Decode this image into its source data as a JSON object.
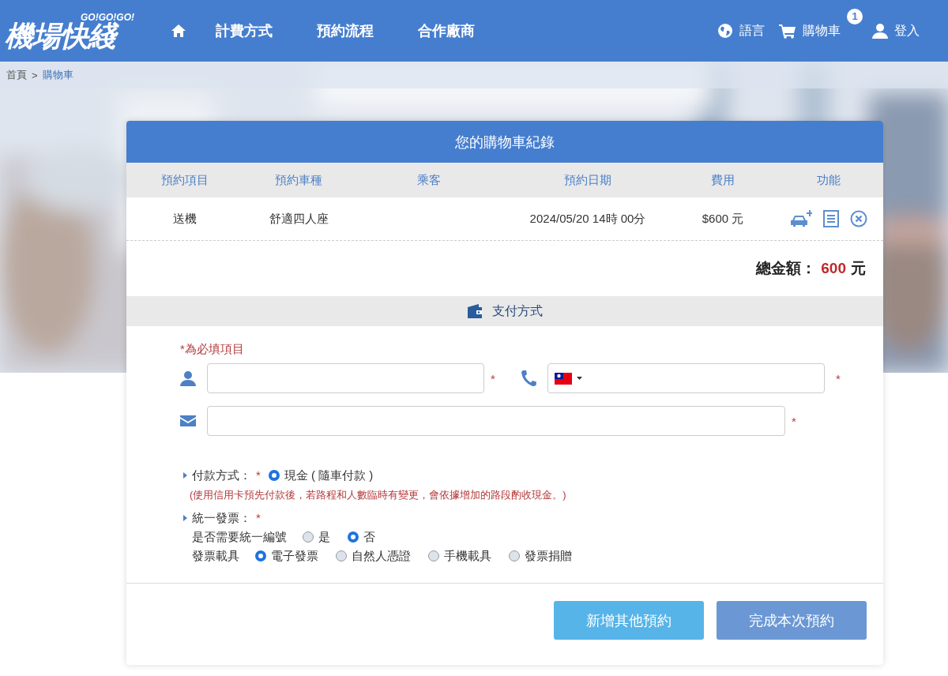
{
  "header": {
    "logo": "機場快綫",
    "logo_tagline": "GO!GO!GO!",
    "nav": [
      "計費方式",
      "預約流程",
      "合作廠商"
    ],
    "language": "語言",
    "cart": "購物車",
    "cart_count": "1",
    "login": "登入"
  },
  "breadcrumb": {
    "home": "首頁",
    "separator": ">",
    "current": "購物車"
  },
  "card": {
    "title": "您的購物車紀錄",
    "columns": [
      "預約項目",
      "預約車種",
      "乘客",
      "預約日期",
      "費用",
      "功能"
    ],
    "rows": [
      {
        "item": "送機",
        "vehicle": "舒適四人座",
        "passenger": "",
        "date": "2024/05/20 14時 00分",
        "fee": "$600 元"
      }
    ],
    "total_label": "總金額：",
    "total_amount": "600",
    "total_unit": "元",
    "payment_title": "支付方式",
    "required_note": "*為必填項目",
    "required_mark": "*",
    "payment": {
      "label": "付款方式：",
      "options": [
        {
          "label": "現金 ( 隨車付款 )",
          "selected": true
        }
      ],
      "note": "(使用信用卡預先付款後，若路程和人數臨時有變更，會依據增加的路段酌收現金。)"
    },
    "invoice": {
      "label": "統一發票：",
      "groups": [
        {
          "label": "是否需要統一編號",
          "options": [
            {
              "label": "是",
              "selected": false
            },
            {
              "label": "否",
              "selected": true
            }
          ]
        },
        {
          "label": "發票載具",
          "options": [
            {
              "label": "電子發票",
              "selected": true
            },
            {
              "label": "自然人憑證",
              "selected": false
            },
            {
              "label": "手機載具",
              "selected": false
            },
            {
              "label": "發票捐贈",
              "selected": false
            }
          ]
        }
      ]
    },
    "buttons": [
      "新增其他預約",
      "完成本次預約"
    ]
  }
}
